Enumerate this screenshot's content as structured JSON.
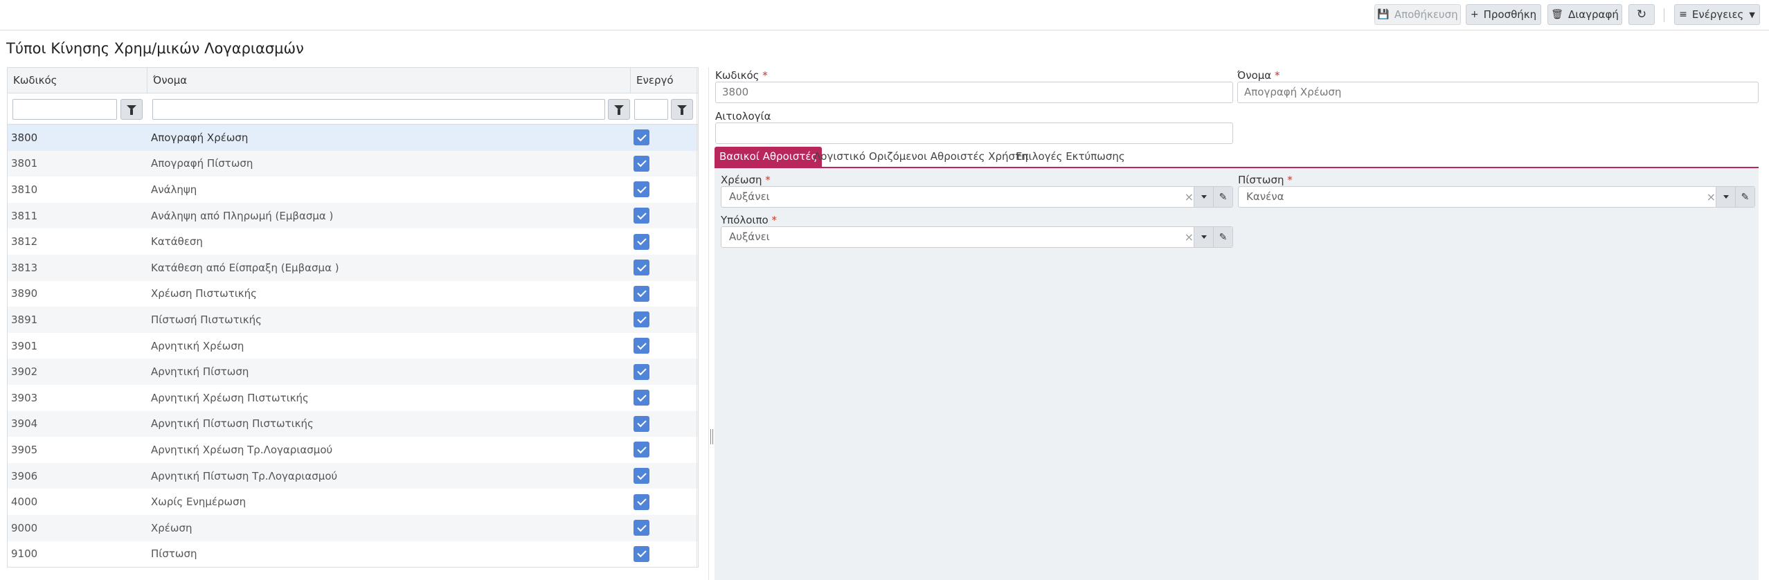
{
  "toolbar": {
    "save_label": "Αποθήκευση",
    "add_label": "Προσθήκη",
    "delete_label": "Διαγραφή",
    "actions_label": "Ενέργειες",
    "icons": {
      "save": "save-icon",
      "add": "plus-icon",
      "delete": "trash-icon",
      "refresh": "refresh-icon",
      "actions": "menu-icon"
    }
  },
  "page": {
    "title": "Τύποι Κίνησης Χρημ/μικών Λογαριασμών"
  },
  "grid": {
    "columns": [
      "Κωδικός",
      "Όνομα",
      "Ενεργό"
    ],
    "filter_values": [
      "",
      "",
      ""
    ],
    "rows": [
      {
        "code": "3800",
        "name": "Απογραφή Χρέωση",
        "active": true
      },
      {
        "code": "3801",
        "name": "Απογραφή Πίστωση",
        "active": true
      },
      {
        "code": "3810",
        "name": "Ανάληψη",
        "active": true
      },
      {
        "code": "3811",
        "name": "Ανάληψη από Πληρωμή (Εμβασμα )",
        "active": true
      },
      {
        "code": "3812",
        "name": "Κατάθεση",
        "active": true
      },
      {
        "code": "3813",
        "name": "Κατάθεση από Είσπραξη (Εμβασμα )",
        "active": true
      },
      {
        "code": "3890",
        "name": "Χρέωση Πιστωτικής",
        "active": true
      },
      {
        "code": "3891",
        "name": "Πίστωσή Πιστωτικής",
        "active": true
      },
      {
        "code": "3901",
        "name": "Αρνητική Χρέωση",
        "active": true
      },
      {
        "code": "3902",
        "name": "Αρνητική Πίστωση",
        "active": true
      },
      {
        "code": "3903",
        "name": "Αρνητική Χρέωση Πιστωτικής",
        "active": true
      },
      {
        "code": "3904",
        "name": "Αρνητική Πίστωση Πιστωτικής",
        "active": true
      },
      {
        "code": "3905",
        "name": "Αρνητική Χρέωση Τρ.Λογαριασμού",
        "active": true
      },
      {
        "code": "3906",
        "name": "Αρνητική Πίστωση Τρ.Λογαριασμού",
        "active": true
      },
      {
        "code": "4000",
        "name": "Χωρίς Ενημέρωση",
        "active": true
      },
      {
        "code": "9000",
        "name": "Χρέωση",
        "active": true
      },
      {
        "code": "9100",
        "name": "Πίστωση",
        "active": true
      }
    ]
  },
  "form": {
    "code_label": "Κωδικός",
    "code_value": "3800",
    "name_label": "Όνομα",
    "name_value": "Απογραφή Χρέωση",
    "reason_label": "Αιτιολογία",
    "reason_value": "",
    "required_mark": "*"
  },
  "tabs": [
    "Βασικοί Αθροιστές",
    "Λογιστικό",
    "Οριζόμενοι Αθροιστές Χρήστη",
    "Επιλογές Εκτύπωσης"
  ],
  "basic": {
    "debit_label": "Χρέωση",
    "debit_value": "Αυξάνει",
    "credit_label": "Πίστωση",
    "credit_value": "Κανένα",
    "balance_label": "Υπόλοιπο",
    "balance_value": "Αυξάνει",
    "clear_glyph": "×"
  },
  "colors": {
    "accent": "#b8265c",
    "checkbox": "#4f84d9",
    "selected_row": "#e3eefa"
  }
}
